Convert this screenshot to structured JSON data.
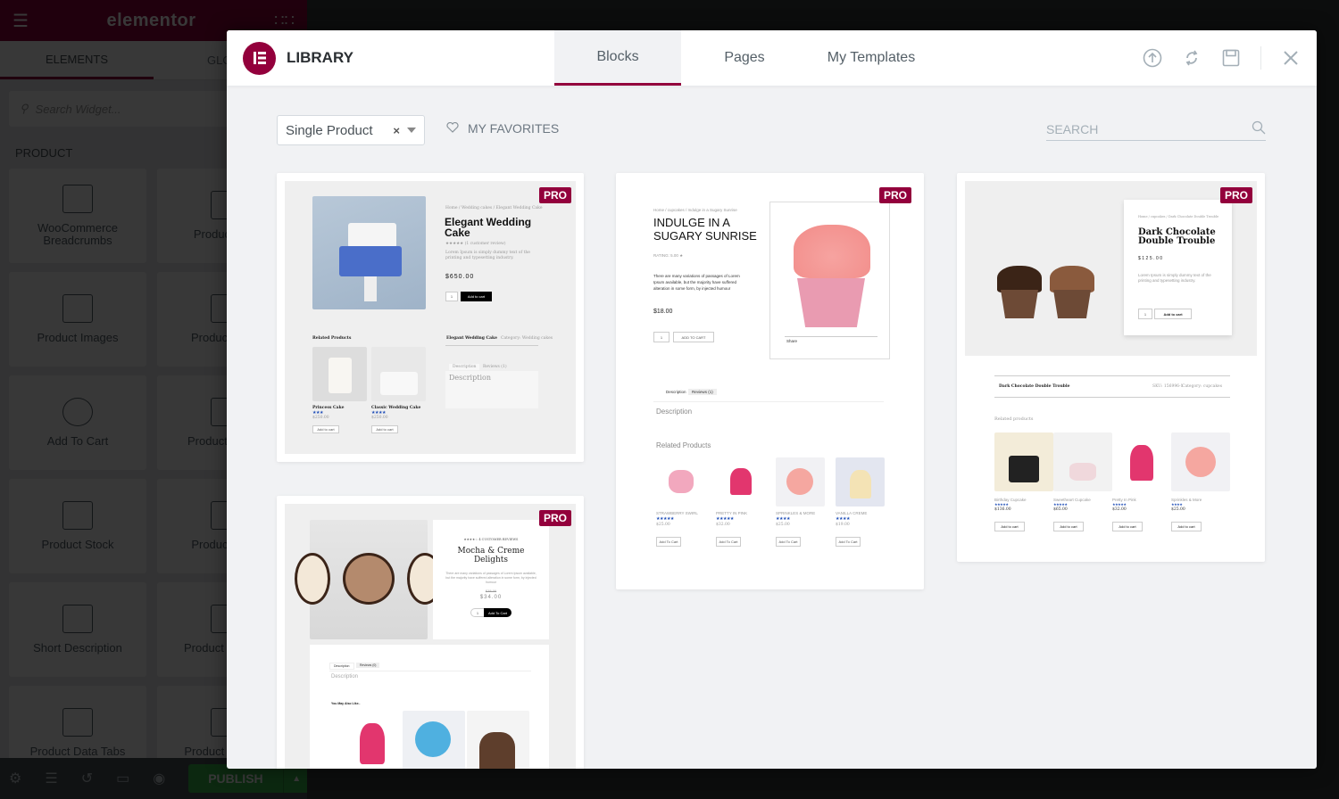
{
  "editor": {
    "logo": "elementor",
    "tabs": [
      "ELEMENTS",
      "GLOBAL"
    ],
    "search_placeholder": "Search Widget...",
    "category": "PRODUCT",
    "widgets": [
      {
        "label": "WooCommerce Breadcrumbs",
        "icon": "breadcrumbs-icon"
      },
      {
        "label": "Product Title",
        "icon": "product-title-icon"
      },
      {
        "label": "Product Images",
        "icon": "product-images-icon"
      },
      {
        "label": "Product Price",
        "icon": "product-price-icon"
      },
      {
        "label": "Add To Cart",
        "icon": "add-to-cart-icon"
      },
      {
        "label": "Product Rating",
        "icon": "product-rating-icon"
      },
      {
        "label": "Product Stock",
        "icon": "product-stock-icon"
      },
      {
        "label": "Product Meta",
        "icon": "product-meta-icon"
      },
      {
        "label": "Short Description",
        "icon": "short-description-icon"
      },
      {
        "label": "Product Content",
        "icon": "product-content-icon"
      },
      {
        "label": "Product Data Tabs",
        "icon": "product-data-tabs-icon"
      },
      {
        "label": "Product Related",
        "icon": "product-related-icon"
      }
    ],
    "bottom": {
      "icons": [
        "settings-icon",
        "navigator-icon",
        "history-icon",
        "responsive-icon",
        "preview-icon"
      ],
      "publish_label": "PUBLISH"
    }
  },
  "library": {
    "title": "LIBRARY",
    "tabs": [
      {
        "label": "Blocks",
        "active": true
      },
      {
        "label": "Pages",
        "active": false
      },
      {
        "label": "My Templates",
        "active": false
      }
    ],
    "actions": [
      "upload-icon",
      "sync-icon",
      "save-icon",
      "close-icon"
    ],
    "filter": {
      "value": "Single Product",
      "clear": "×"
    },
    "favorites_label": "MY FAVORITES",
    "search_placeholder": "SEARCH",
    "pro_badge": "PRO",
    "accent": "#93003c",
    "templates": [
      {
        "name": "Elegant Wedding Cake",
        "breadcrumb": "Home / Wedding cakes / Elegant Wedding Cake",
        "title_l1": "Elegant Wedding",
        "title_l2": "Cake",
        "review": "★★★★★ (1 customer review)",
        "desc": "Lorem Ipsum is simply dummy text of the printing and typesetting industry.",
        "price": "$650.00",
        "qty": "1",
        "cart": "Add to cart",
        "meta_title": "Elegant Wedding Cake",
        "meta_category": "Category: Wedding cakes",
        "tab1": "Description",
        "tab2": "Reviews (1)",
        "desc_heading": "Description",
        "related_heading": "Related Products",
        "related": [
          {
            "name": "Princess Cake",
            "price": "$250.00",
            "cart": "Add to cart"
          },
          {
            "name": "Classic Wedding Cake",
            "price": "$250.00",
            "cart": "Add to cart"
          }
        ]
      },
      {
        "name": "Indulge in a Sugary Sunrise",
        "breadcrumb": "Home / cupcakes / Indulge in a Sugary Sunrise",
        "title_l1": "INDULGE IN A",
        "title_l2": "SUGARY SUNRISE",
        "rating": "RATING: 5.00 ★",
        "desc": "There are many variations of passages of Lorem Ipsum available, but the majority have suffered alteration in some form, by injected humour",
        "price": "$18.00",
        "qty": "1",
        "cart": "ADD TO CART",
        "share": "Share",
        "tab1": "Description",
        "tab2": "Reviews (1)",
        "desc_heading": "Description",
        "related_heading": "Related Products",
        "related": [
          {
            "name": "STRAWBERRY SWIRL",
            "price": "$25.00",
            "cart": "Add To Cart"
          },
          {
            "name": "PRETTY IN PINK",
            "price": "$32.00",
            "cart": "Add To Cart"
          },
          {
            "name": "SPRINKLES & MORE",
            "price": "$25.00",
            "cart": "Add To Cart"
          },
          {
            "name": "VANILLA CREME",
            "price": "$19.00",
            "cart": "Add To Cart"
          }
        ]
      },
      {
        "name": "Dark Chocolate Double Trouble",
        "breadcrumb": "Home / cupcakes / Dark Chocolate Double Trouble",
        "title_l1": "Dark Chocolate",
        "title_l2": "Double Trouble",
        "price": "$125.00",
        "desc": "Lorem Ipsum is simply dummy text of the printing and typesetting industry.",
        "qty": "1",
        "cart": "Add to cart",
        "meta_title": "Dark Chocolate Double Trouble",
        "meta_sku": "SKU: 156996-1",
        "meta_category": "Category: cupcakes",
        "related_heading": "Related products",
        "related": [
          {
            "name": "Birthday Cupcake",
            "price": "$136.00",
            "cart": "Add to cart"
          },
          {
            "name": "Sweetheart Cupcake",
            "price": "$65.00",
            "cart": "Add to cart"
          },
          {
            "name": "Pretty In Pink",
            "price": "$32.00",
            "cart": "Add to cart"
          },
          {
            "name": "Sprinkles & More",
            "price": "$25.00",
            "cart": "Add to cart"
          }
        ]
      },
      {
        "name": "Mocha & Creme Delights",
        "reviews": "★★★★☆ 4 CUSTOMER REVIEWS",
        "title_l1": "Mocha & Creme",
        "title_l2": "Delights",
        "desc": "There are many variations of passages of Lorem Ipsum available, but the majority have suffered alteration in some form, by injected humour",
        "old_price": "$38.00",
        "price": "$34.00",
        "qty": "1",
        "cart": "Add To Cart",
        "tab1": "Description",
        "tab2": "Reviews (0)",
        "desc_heading": "Description",
        "related_heading": "You May Also Like.."
      }
    ]
  }
}
